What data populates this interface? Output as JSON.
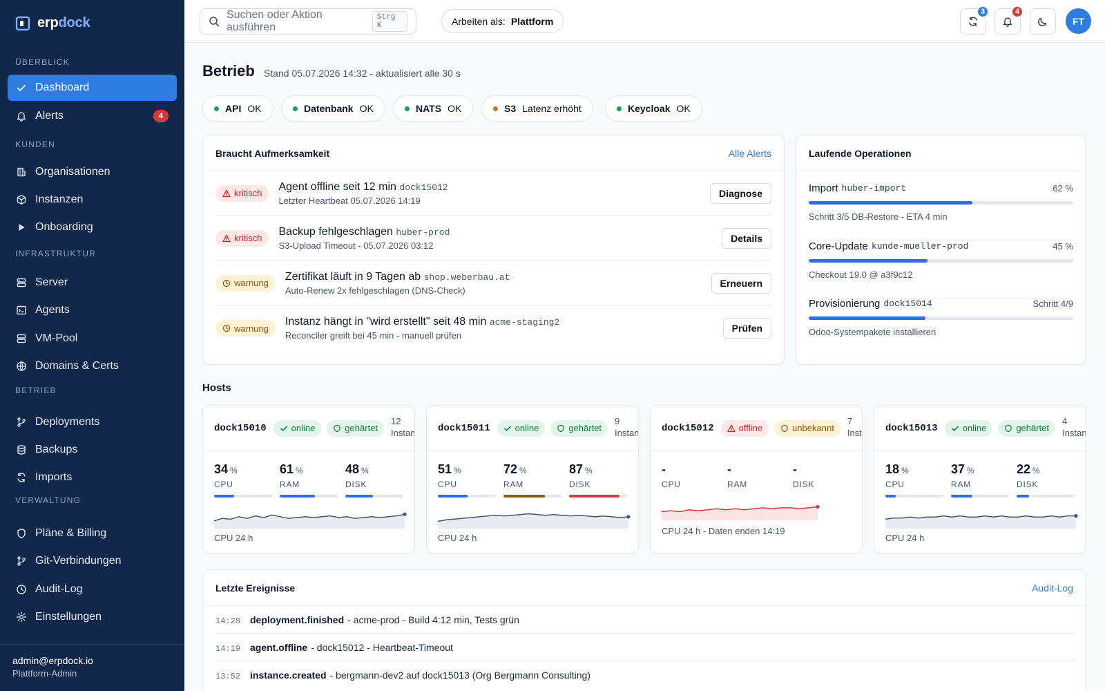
{
  "app": {
    "brand_a": "erp",
    "brand_b": "dock"
  },
  "sidebar": {
    "sections": [
      {
        "title": "ÜBERBLICK",
        "items": [
          {
            "label": "Dashboard",
            "icon": "check-icon",
            "active": true
          },
          {
            "label": "Alerts",
            "icon": "bell-icon",
            "badge": "4"
          }
        ]
      },
      {
        "title": "KUNDEN",
        "items": [
          {
            "label": "Organisationen",
            "icon": "building-icon"
          },
          {
            "label": "Instanzen",
            "icon": "cube-icon"
          },
          {
            "label": "Onboarding",
            "icon": "play-icon"
          }
        ]
      },
      {
        "title": "INFRASTRUKTUR",
        "items": [
          {
            "label": "Server",
            "icon": "server-icon"
          },
          {
            "label": "Agents",
            "icon": "terminal-icon"
          },
          {
            "label": "VM-Pool",
            "icon": "stack-icon"
          },
          {
            "label": "Domains & Certs",
            "icon": "globe-icon"
          }
        ]
      },
      {
        "title": "BETRIEB",
        "items": [
          {
            "label": "Deployments",
            "icon": "git-branch-icon"
          },
          {
            "label": "Backups",
            "icon": "database-icon"
          },
          {
            "label": "Imports",
            "icon": "refresh-icon"
          }
        ]
      },
      {
        "title": "VERWALTUNG",
        "items": [
          {
            "label": "Pläne & Billing",
            "icon": "shield-icon"
          },
          {
            "label": "Git-Verbindungen",
            "icon": "git-branch-icon"
          },
          {
            "label": "Audit-Log",
            "icon": "clock-icon"
          },
          {
            "label": "Einstellungen",
            "icon": "gear-icon"
          }
        ]
      }
    ],
    "user_email": "admin@erpdock.io",
    "user_role": "Plattform-Admin"
  },
  "topbar": {
    "search_placeholder": "Suchen oder Aktion ausführen",
    "search_shortcut": "Strg K",
    "work_as_label": "Arbeiten als:",
    "work_as_value": "Plattform",
    "sync_badge": "3",
    "notif_badge": "4",
    "avatar_initials": "FT"
  },
  "page": {
    "title": "Betrieb",
    "subtitle": "Stand 05.07.2026 14:32 - aktualisiert alle 30 s"
  },
  "status_pills": [
    {
      "name": "API",
      "status": "OK",
      "color": "#16a34a"
    },
    {
      "name": "Datenbank",
      "status": "OK",
      "color": "#16a34a"
    },
    {
      "name": "NATS",
      "status": "OK",
      "color": "#16a34a"
    },
    {
      "name": "S3",
      "status": "Latenz erhöht",
      "color": "#b7791f"
    },
    {
      "name": "Keycloak",
      "status": "OK",
      "color": "#16a34a"
    }
  ],
  "attention": {
    "title": "Braucht Aufmerksamkeit",
    "link": "Alle Alerts",
    "items": [
      {
        "severity": "kritisch",
        "level": "crit",
        "title": "Agent offline seit 12 min",
        "code": "dock15012",
        "sub": "Letzter Heartbeat 05.07.2026 14:19",
        "action": "Diagnose"
      },
      {
        "severity": "kritisch",
        "level": "crit",
        "title": "Backup fehlgeschlagen",
        "code": "huber-prod",
        "sub": "S3-Upload Timeout - 05.07.2026 03:12",
        "action": "Details"
      },
      {
        "severity": "warnung",
        "level": "warn",
        "title": "Zertifikat läuft in 9 Tagen ab",
        "code": "shop.weberbau.at",
        "sub": "Auto-Renew 2x fehlgeschlagen (DNS-Check)",
        "action": "Erneuern"
      },
      {
        "severity": "warnung",
        "level": "warn",
        "title": "Instanz hängt in \"wird erstellt\" seit 48 min",
        "code": "acme-staging2",
        "sub": "Reconciler greift bei 45 min - manuell prüfen",
        "action": "Prüfen"
      }
    ]
  },
  "operations": {
    "title": "Laufende Operationen",
    "items": [
      {
        "title": "Import",
        "code": "huber-import",
        "right": "62 %",
        "progress": 0.62,
        "sub": "Schritt 3/5 DB-Restore - ETA 4 min"
      },
      {
        "title": "Core-Update",
        "code": "kunde-mueller-prod",
        "right": "45 %",
        "progress": 0.45,
        "sub": "Checkout 19.0 @ a3f9c12"
      },
      {
        "title": "Provisionierung",
        "code": "dock15014",
        "right": "Schritt 4/9",
        "progress": 0.44,
        "sub": "Odoo-Systempakete installieren"
      }
    ]
  },
  "hosts": {
    "title": "Hosts",
    "items": [
      {
        "name": "dock15010",
        "status": "online",
        "status_level": "ok",
        "hardening": "gehärtet",
        "hardening_level": "ok",
        "count": "12",
        "count_label": "Instanzen",
        "metrics": [
          {
            "value": "34",
            "unit": "%",
            "label": "CPU",
            "fill": 0.34,
            "color": "#2f6ee0"
          },
          {
            "value": "61",
            "unit": "%",
            "label": "RAM",
            "fill": 0.61,
            "color": "#2f6ee0"
          },
          {
            "value": "48",
            "unit": "%",
            "label": "DISK",
            "fill": 0.48,
            "color": "#2f6ee0"
          }
        ],
        "spark": [
          30,
          33,
          32,
          35,
          33,
          36,
          34,
          37,
          35,
          33,
          34,
          35,
          34,
          35,
          36,
          34,
          35,
          33,
          34,
          35,
          34,
          35,
          36,
          38
        ],
        "caption": "CPU 24 h",
        "spark_color": "#475569"
      },
      {
        "name": "dock15011",
        "status": "online",
        "status_level": "ok",
        "hardening": "gehärtet",
        "hardening_level": "ok",
        "count": "9",
        "count_label": "Instanzen",
        "metrics": [
          {
            "value": "51",
            "unit": "%",
            "label": "CPU",
            "fill": 0.51,
            "color": "#2f6ee0"
          },
          {
            "value": "72",
            "unit": "%",
            "label": "RAM",
            "fill": 0.72,
            "color": "#8a5a08"
          },
          {
            "value": "87",
            "unit": "%",
            "label": "DISK",
            "fill": 0.87,
            "color": "#d33a3a"
          }
        ],
        "spark": [
          46,
          48,
          49,
          50,
          51,
          52,
          53,
          54,
          53,
          54,
          55,
          56,
          55,
          54,
          55,
          54,
          53,
          54,
          53,
          52,
          53,
          52,
          51,
          52
        ],
        "caption": "CPU 24 h",
        "spark_color": "#475569"
      },
      {
        "name": "dock15012",
        "status": "offline",
        "status_level": "bad",
        "hardening": "unbekannt",
        "hardening_level": "unk",
        "count": "7",
        "count_label": "Instanzen",
        "metrics": [
          {
            "value": "-",
            "unit": "",
            "label": "CPU"
          },
          {
            "value": "-",
            "unit": "",
            "label": "RAM"
          },
          {
            "value": "-",
            "unit": "",
            "label": "DISK"
          }
        ],
        "spark": [
          40,
          41,
          40,
          42,
          41,
          42,
          43,
          42,
          43,
          42,
          43,
          44,
          43,
          44,
          44,
          43,
          44,
          45
        ],
        "caption": "CPU 24 h - Daten enden 14:19",
        "spark_color": "#d33a3a"
      },
      {
        "name": "dock15013",
        "status": "online",
        "status_level": "ok",
        "hardening": "gehärtet",
        "hardening_level": "ok",
        "count": "4",
        "count_label": "Instanzen",
        "metrics": [
          {
            "value": "18",
            "unit": "%",
            "label": "CPU",
            "fill": 0.18,
            "color": "#2f6ee0"
          },
          {
            "value": "37",
            "unit": "%",
            "label": "RAM",
            "fill": 0.37,
            "color": "#2f6ee0"
          },
          {
            "value": "22",
            "unit": "%",
            "label": "DISK",
            "fill": 0.22,
            "color": "#2f6ee0"
          }
        ],
        "spark": [
          16,
          17,
          17,
          18,
          17,
          18,
          18,
          19,
          18,
          19,
          18,
          18,
          19,
          18,
          19,
          18,
          18,
          19,
          18,
          18,
          19,
          18,
          19,
          19
        ],
        "caption": "CPU 24 h",
        "spark_color": "#475569"
      }
    ]
  },
  "events": {
    "title": "Letzte Ereignisse",
    "link": "Audit-Log",
    "items": [
      {
        "time": "14:28",
        "type": "deployment.finished",
        "text": "- acme-prod - Build 4:12 min, Tests grün"
      },
      {
        "time": "14:19",
        "type": "agent.offline",
        "text": "- dock15012 - Heartbeat-Timeout"
      },
      {
        "time": "13:52",
        "type": "instance.created",
        "text": "- bergmann-dev2 auf dock15013 (Org Bergmann Consulting)"
      }
    ]
  }
}
